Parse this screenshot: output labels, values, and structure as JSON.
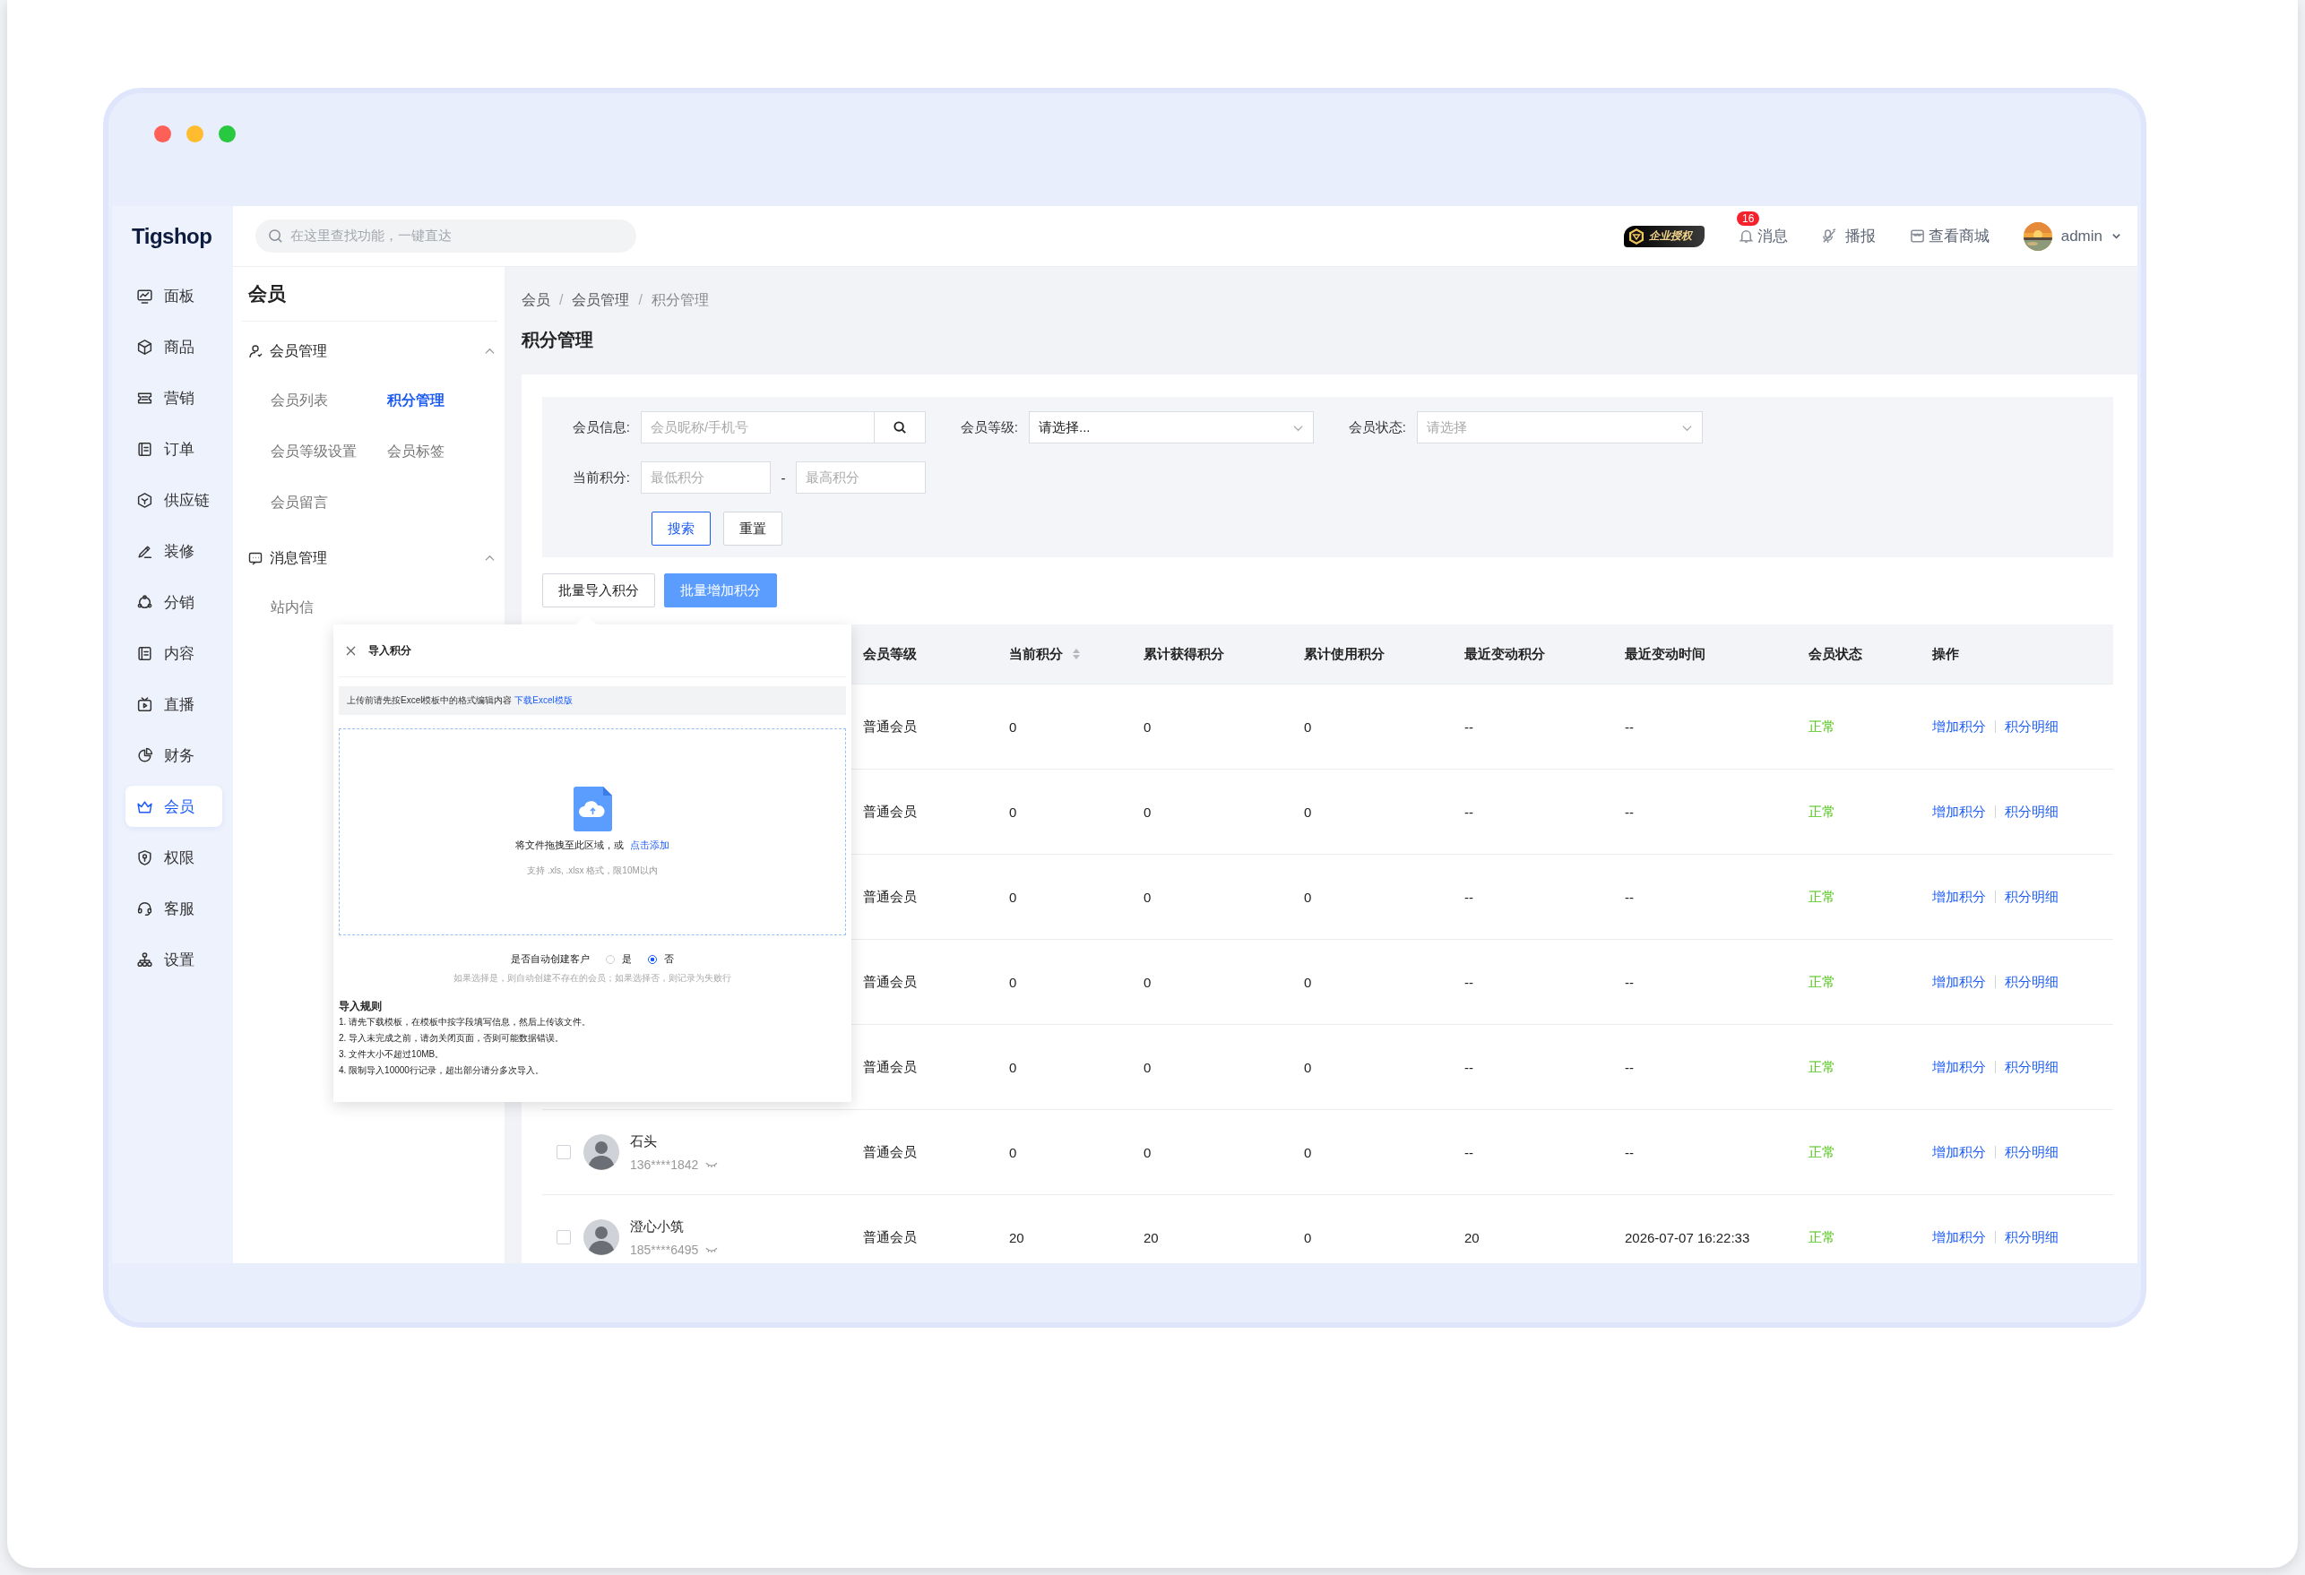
{
  "logo": {
    "text": "Tigshop"
  },
  "nav": [
    {
      "label": "面板",
      "selected": false
    },
    {
      "label": "商品",
      "selected": false
    },
    {
      "label": "营销",
      "selected": false
    },
    {
      "label": "订单",
      "selected": false
    },
    {
      "label": "供应链",
      "selected": false
    },
    {
      "label": "装修",
      "selected": false
    },
    {
      "label": "分销",
      "selected": false
    },
    {
      "label": "内容",
      "selected": false
    },
    {
      "label": "直播",
      "selected": false
    },
    {
      "label": "财务",
      "selected": false
    },
    {
      "label": "会员",
      "selected": true
    },
    {
      "label": "权限",
      "selected": false
    },
    {
      "label": "客服",
      "selected": false
    },
    {
      "label": "设置",
      "selected": false
    }
  ],
  "search": {
    "placeholder": "在这里查找功能，一键直达"
  },
  "header": {
    "license_badge": "企业授权",
    "messages": {
      "label": "消息",
      "badge": "16"
    },
    "broadcast": "播报",
    "view_store": "查看商城",
    "user": "admin"
  },
  "submenu": {
    "title": "会员",
    "groups": [
      {
        "label": "会员管理",
        "expanded": true,
        "items": [
          {
            "label": "会员列表",
            "selected": false
          },
          {
            "label": "积分管理",
            "selected": true
          },
          {
            "label": "会员等级设置",
            "selected": false
          },
          {
            "label": "会员标签",
            "selected": false
          },
          {
            "label": "会员留言",
            "selected": false
          }
        ]
      },
      {
        "label": "消息管理",
        "expanded": true,
        "items": [
          {
            "label": "站内信",
            "selected": false
          }
        ]
      }
    ]
  },
  "breadcrumb": {
    "separator": "/",
    "items": [
      "会员",
      "会员管理",
      "积分管理"
    ]
  },
  "page_title": "积分管理",
  "filters": {
    "member_info": {
      "label": "会员信息:",
      "placeholder": "会员昵称/手机号"
    },
    "member_level": {
      "label": "会员等级:",
      "value": "请选择..."
    },
    "member_status": {
      "label": "会员状态:",
      "placeholder": "请选择"
    },
    "points": {
      "label": "当前积分:",
      "min_placeholder": "最低积分",
      "separator": "-",
      "max_placeholder": "最高积分"
    },
    "buttons": [
      {
        "label": "搜索",
        "kind": "primary"
      },
      {
        "label": "重置",
        "kind": "default"
      }
    ]
  },
  "actions": [
    {
      "label": "批量导入积分",
      "kind": "default"
    },
    {
      "label": "批量增加积分",
      "kind": "primary"
    }
  ],
  "table": {
    "columns": [
      {
        "label": "会员等级",
        "sortable": false
      },
      {
        "label": "当前积分",
        "sortable": true
      },
      {
        "label": "累计获得积分",
        "sortable": false
      },
      {
        "label": "累计使用积分",
        "sortable": false
      },
      {
        "label": "最近变动积分",
        "sortable": false
      },
      {
        "label": "最近变动时间",
        "sortable": false
      },
      {
        "label": "会员状态",
        "sortable": false
      },
      {
        "label": "操作",
        "sortable": false
      }
    ],
    "rows": [
      {
        "cells": [
          "普通会员",
          "0",
          "0",
          "0",
          "--",
          "--",
          "正常"
        ],
        "actions": [
          "增加积分",
          "积分明细"
        ]
      },
      {
        "cells": [
          "普通会员",
          "0",
          "0",
          "0",
          "--",
          "--",
          "正常"
        ],
        "actions": [
          "增加积分",
          "积分明细"
        ]
      },
      {
        "cells": [
          "普通会员",
          "0",
          "0",
          "0",
          "--",
          "--",
          "正常"
        ],
        "actions": [
          "增加积分",
          "积分明细"
        ]
      },
      {
        "cells": [
          "普通会员",
          "0",
          "0",
          "0",
          "--",
          "--",
          "正常"
        ],
        "actions": [
          "增加积分",
          "积分明细"
        ]
      },
      {
        "cells": [
          "普通会员",
          "0",
          "0",
          "0",
          "--",
          "--",
          "正常"
        ],
        "actions": [
          "增加积分",
          "积分明细"
        ]
      },
      {
        "member": {
          "name": "石头",
          "phone": "136****1842",
          "checked": false
        },
        "cells": [
          "普通会员",
          "0",
          "0",
          "0",
          "--",
          "--",
          "正常"
        ],
        "actions": [
          "增加积分",
          "积分明细"
        ]
      },
      {
        "member": {
          "name": "澄心小筑",
          "phone": "185****6495",
          "checked": false
        },
        "cells": [
          "普通会员",
          "20",
          "20",
          "0",
          "20",
          "2026-07-07 16:22:33",
          "正常"
        ],
        "actions": [
          "增加积分",
          "积分明细"
        ]
      }
    ]
  },
  "import_popup": {
    "title": "导入积分",
    "notice": "上传前请先按Excel模板中的格式编辑内容",
    "notice_link": "下载Excel模版",
    "drop_text": "将文件拖拽至此区域，或",
    "drop_link": "点击添加",
    "drop_hint": "支持 .xls, .xlsx 格式，限10M以内",
    "auto_create": {
      "label": "是否自动创建客户",
      "options": [
        {
          "label": "是",
          "selected": false
        },
        {
          "label": "否",
          "selected": true
        }
      ]
    },
    "auto_create_note": "如果选择是，则自动创建不存在的会员；如果选择否，则记录为失败行",
    "rules_title": "导入规则",
    "rules": [
      "1. 请先下载模板，在模板中按字段填写信息，然后上传该文件。",
      "2. 导入未完成之前，请勿关闭页面，否则可能数据错误。",
      "3. 文件大小不超过10MB。",
      "4. 限制导入10000行记录，超出部分请分多次导入。"
    ]
  }
}
